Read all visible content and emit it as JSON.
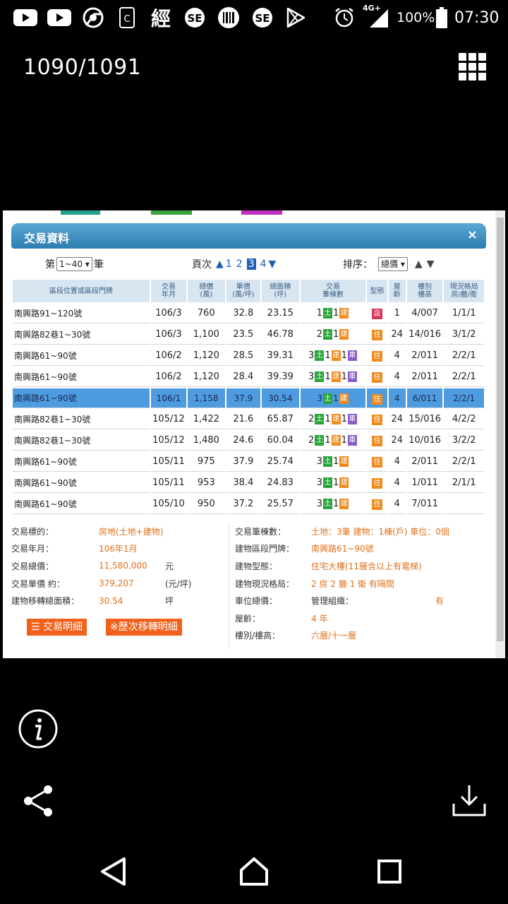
{
  "status_bar": {
    "network": "4G+",
    "battery": "100%",
    "time": "07:30",
    "left_icons": [
      "youtube-icon",
      "youtube-icon",
      "chrome-icon",
      "app-c-icon",
      "jing-news-icon",
      "setn-icon",
      "barcode-app-icon",
      "setn-icon",
      "play-store-icon"
    ],
    "jing_char": "經"
  },
  "viewer": {
    "counter": "1090/1091"
  },
  "panel": {
    "title": "交易資料",
    "close": "×",
    "range_prefix": "第",
    "range_value": "1~40",
    "range_suffix": "筆",
    "page_label": "頁次",
    "pages": [
      "1",
      "2",
      "3",
      "4"
    ],
    "current_page": "3",
    "sort_label": "排序：",
    "sort_value": "總價"
  },
  "table": {
    "headers": [
      "區段位置或區段門牌",
      "交易\n年月",
      "總價\n(萬)",
      "單價\n(萬/坪)",
      "總面積\n(坪)",
      "交易\n筆棟數",
      "型態",
      "屋\n齡",
      "樓別\n樓高",
      "現況格局\n房/廳/衛"
    ],
    "rows": [
      {
        "addr": "南興路91~120號",
        "ym": "106/3",
        "total": "760",
        "unit": "32.8",
        "area": "23.15",
        "land": "1",
        "build": "1",
        "park": "",
        "type": "店",
        "age": "1",
        "floor": "4/007",
        "layout": "1/1/1"
      },
      {
        "addr": "南興路82巷1~30號",
        "ym": "106/3",
        "total": "1,100",
        "unit": "23.5",
        "area": "46.78",
        "land": "2",
        "build": "1",
        "park": "",
        "type": "住",
        "age": "24",
        "floor": "14/016",
        "layout": "3/1/2"
      },
      {
        "addr": "南興路61~90號",
        "ym": "106/2",
        "total": "1,120",
        "unit": "28.5",
        "area": "39.31",
        "land": "3",
        "build": "1",
        "park": "1",
        "type": "住",
        "age": "4",
        "floor": "2/011",
        "layout": "2/2/1"
      },
      {
        "addr": "南興路61~90號",
        "ym": "106/2",
        "total": "1,120",
        "unit": "28.4",
        "area": "39.39",
        "land": "3",
        "build": "1",
        "park": "1",
        "type": "住",
        "age": "4",
        "floor": "2/011",
        "layout": "2/2/1"
      },
      {
        "addr": "南興路61~90號",
        "ym": "106/1",
        "total": "1,158",
        "unit": "37.9",
        "area": "30.54",
        "land": "3",
        "build": "1",
        "park": "",
        "type": "住",
        "age": "4",
        "floor": "6/011",
        "layout": "2/2/1",
        "selected": true
      },
      {
        "addr": "南興路82巷1~30號",
        "ym": "105/12",
        "total": "1,422",
        "unit": "21.6",
        "area": "65.87",
        "land": "2",
        "build": "1",
        "park": "1",
        "type": "住",
        "age": "24",
        "floor": "15/016",
        "layout": "4/2/2"
      },
      {
        "addr": "南興路82巷1~30號",
        "ym": "105/12",
        "total": "1,480",
        "unit": "24.6",
        "area": "60.04",
        "land": "2",
        "build": "1",
        "park": "1",
        "type": "住",
        "age": "24",
        "floor": "10/016",
        "layout": "3/2/2"
      },
      {
        "addr": "南興路61~90號",
        "ym": "105/11",
        "total": "975",
        "unit": "37.9",
        "area": "25.74",
        "land": "3",
        "build": "1",
        "park": "",
        "type": "住",
        "age": "4",
        "floor": "2/011",
        "layout": "2/2/1"
      },
      {
        "addr": "南興路61~90號",
        "ym": "105/11",
        "total": "953",
        "unit": "38.4",
        "area": "24.83",
        "land": "3",
        "build": "1",
        "park": "",
        "type": "住",
        "age": "4",
        "floor": "1/011",
        "layout": "2/1/1"
      },
      {
        "addr": "南興路61~90號",
        "ym": "105/10",
        "total": "950",
        "unit": "37.2",
        "area": "25.57",
        "land": "3",
        "build": "1",
        "park": "",
        "type": "住",
        "age": "4",
        "floor": "7/011",
        "layout": ""
      }
    ],
    "badges": {
      "land": "土",
      "build": "建",
      "park": "車"
    }
  },
  "detail": {
    "left": [
      {
        "k": "交易標的：",
        "v": "房地(土地+建物)",
        "u": ""
      },
      {
        "k": "交易年月：",
        "v": "106年1月",
        "u": ""
      },
      {
        "k": "交易總價：",
        "v": "11,580,000",
        "u": "元"
      },
      {
        "k": "交易單價 約：",
        "v": "379,207",
        "u": "(元/坪)"
      },
      {
        "k": "建物移轉總面積：",
        "v": "30.54",
        "u": "坪"
      }
    ],
    "right": [
      {
        "k": "交易筆棟數：",
        "v": "土地：3筆 建物：1棟(戶) 車位：0個"
      },
      {
        "k": "建物區段門牌：",
        "v": "南興路61~90號"
      },
      {
        "k": "建物型態：",
        "v": "住宅大樓(11層含以上有電梯)"
      },
      {
        "k": "建物現況格局：",
        "v": "2 房 2 廳 1 衛 有隔間"
      },
      {
        "k": "車位總價：",
        "v": "管理組織：",
        "v2": "有"
      },
      {
        "k": "屋齡：",
        "v": "4 年"
      },
      {
        "k": "樓別/樓高：",
        "v": "六層/十一層"
      }
    ],
    "btn_detail": "交易明細",
    "btn_history": "※歷次移轉明細"
  }
}
